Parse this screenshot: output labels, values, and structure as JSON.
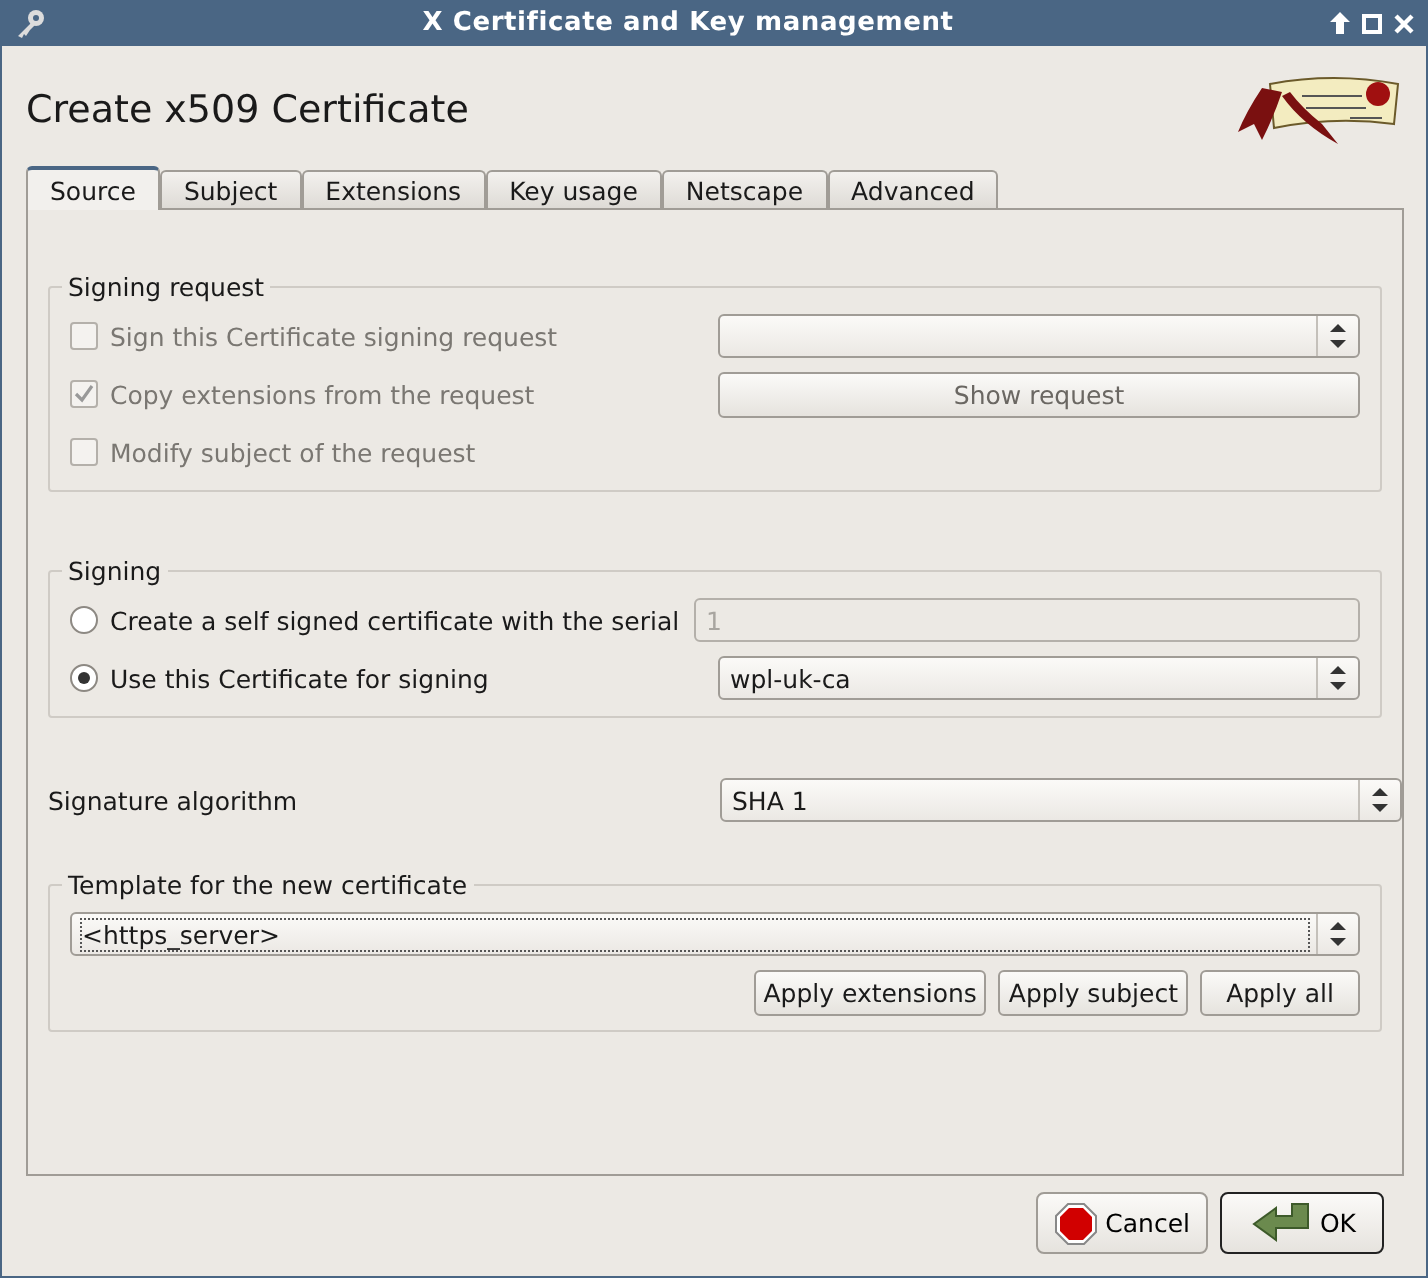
{
  "window": {
    "title": "X Certificate and Key management"
  },
  "heading": "Create x509 Certificate",
  "tabs": [
    {
      "label": "Source",
      "selected": true
    },
    {
      "label": "Subject",
      "selected": false
    },
    {
      "label": "Extensions",
      "selected": false
    },
    {
      "label": "Key usage",
      "selected": false
    },
    {
      "label": "Netscape",
      "selected": false
    },
    {
      "label": "Advanced",
      "selected": false
    }
  ],
  "signing_request": {
    "title": "Signing request",
    "options": [
      {
        "label": "Sign this Certificate signing request",
        "checked": false,
        "disabled": true
      },
      {
        "label": "Copy extensions from the request",
        "checked": true,
        "disabled": true
      },
      {
        "label": "Modify subject of the request",
        "checked": false,
        "disabled": true
      }
    ],
    "button": "Show request"
  },
  "signing": {
    "title": "Signing",
    "options": [
      {
        "label": "Create a self signed certificate with the serial",
        "selected": false
      },
      {
        "label": "Use this Certificate for signing",
        "selected": true
      }
    ],
    "serial": {
      "value": "1",
      "disabled": true
    },
    "certificate": "wpl-uk-ca"
  },
  "signature_algorithm": {
    "label": "Signature algorithm",
    "value": "SHA 1"
  },
  "template": {
    "title": "Template for the new certificate",
    "value": "<https_server>",
    "buttons": [
      "Apply extensions",
      "Apply subject",
      "Apply all"
    ]
  },
  "buttons": [
    {
      "label": "Cancel",
      "kind": "cancel"
    },
    {
      "label": "OK",
      "kind": "ok"
    }
  ]
}
